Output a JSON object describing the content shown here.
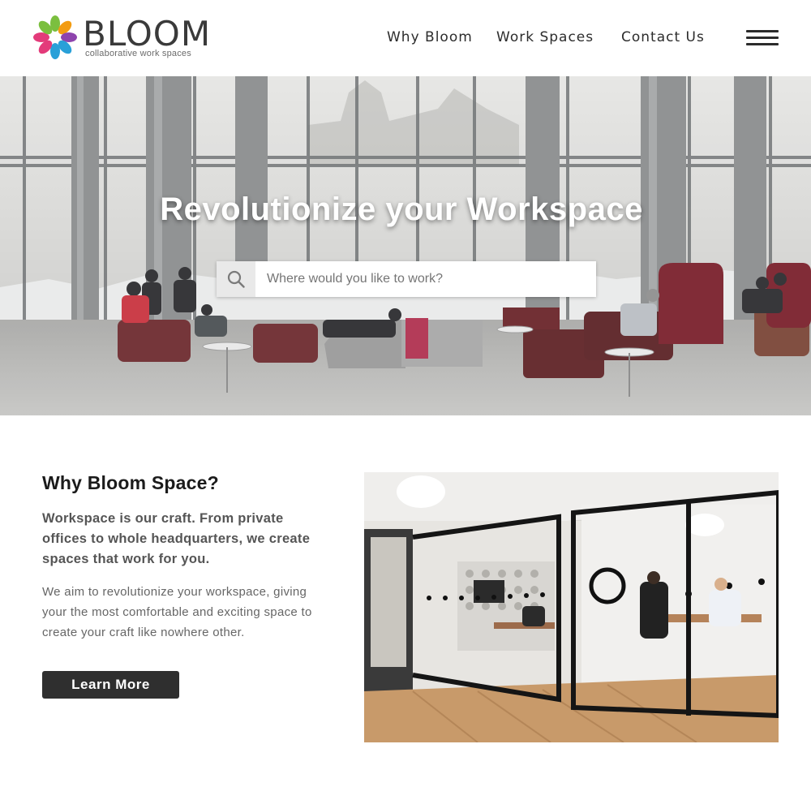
{
  "brand": {
    "name": "BLOOM",
    "tagline": "collaborative work spaces",
    "colors": [
      "#e33b7a",
      "#7bbf3f",
      "#29a0d8",
      "#8e44ad",
      "#f39c12"
    ]
  },
  "nav": {
    "items": [
      {
        "label": "Why Bloom"
      },
      {
        "label": "Work Spaces"
      },
      {
        "label": "Contact Us"
      }
    ],
    "menu_icon": "hamburger-menu-icon"
  },
  "hero": {
    "title": "Revolutionize your Workspace",
    "search": {
      "placeholder": "Where would you like to work?",
      "value": "",
      "icon": "search-icon"
    }
  },
  "why": {
    "title": "Why Bloom Space?",
    "lead": "Workspace is our craft. From private offices to whole headquarters, we create spaces that work for you.",
    "body": "We aim to revolutionize your workspace, giving your the most comfortable and exciting space to create your craft like nowhere other.",
    "button_label": "Learn More"
  }
}
